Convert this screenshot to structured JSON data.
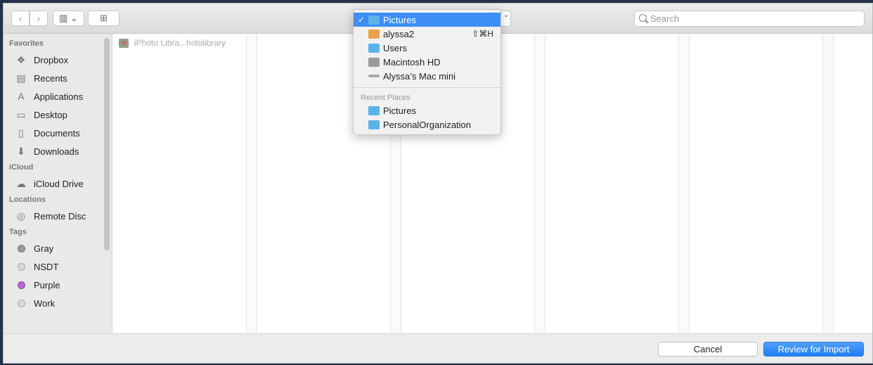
{
  "toolbar": {
    "back": "‹",
    "forward": "›",
    "view": "▥ ⌄",
    "new_folder": "⊞",
    "search_placeholder": "Search",
    "popup_arrows": "⌃⌄"
  },
  "sidebar": {
    "favorites_label": "Favorites",
    "favorites": [
      {
        "label": "Dropbox",
        "icon": "dropbox-icon",
        "glyph": "❖"
      },
      {
        "label": "Recents",
        "icon": "recents-icon",
        "glyph": "▤"
      },
      {
        "label": "Applications",
        "icon": "applications-icon",
        "glyph": "A"
      },
      {
        "label": "Desktop",
        "icon": "desktop-icon",
        "glyph": "▭"
      },
      {
        "label": "Documents",
        "icon": "documents-icon",
        "glyph": "▯"
      },
      {
        "label": "Downloads",
        "icon": "downloads-icon",
        "glyph": "⬇"
      }
    ],
    "icloud_label": "iCloud",
    "icloud": [
      {
        "label": "iCloud Drive",
        "icon": "cloud-icon",
        "glyph": "☁"
      }
    ],
    "locations_label": "Locations",
    "locations": [
      {
        "label": "Remote Disc",
        "icon": "disc-icon",
        "glyph": "◎"
      }
    ],
    "tags_label": "Tags",
    "tags": [
      {
        "label": "Gray",
        "color": "#9a9a9a"
      },
      {
        "label": "NSDT",
        "color": "#d8d8d8"
      },
      {
        "label": "Purple",
        "color": "#b665d9"
      },
      {
        "label": "Work",
        "color": "#d8d8d8"
      }
    ]
  },
  "browser": {
    "file": "iPhoto Libra...hotolibrary"
  },
  "menu": {
    "items": [
      {
        "label": "Pictures",
        "selected": true,
        "check": "✓"
      },
      {
        "label": "alyssa2",
        "shortcut": "⇧⌘H"
      },
      {
        "label": "Users"
      },
      {
        "label": "Macintosh HD"
      },
      {
        "label": "Alyssa’s Mac mini"
      }
    ],
    "recent_label": "Recent Places",
    "recent": [
      {
        "label": "Pictures"
      },
      {
        "label": "PersonalOrganization"
      }
    ]
  },
  "buttons": {
    "cancel": "Cancel",
    "primary": "Review for Import"
  },
  "colors": {
    "accent": "#3d8ef7",
    "folder": "#5bb3ea"
  }
}
